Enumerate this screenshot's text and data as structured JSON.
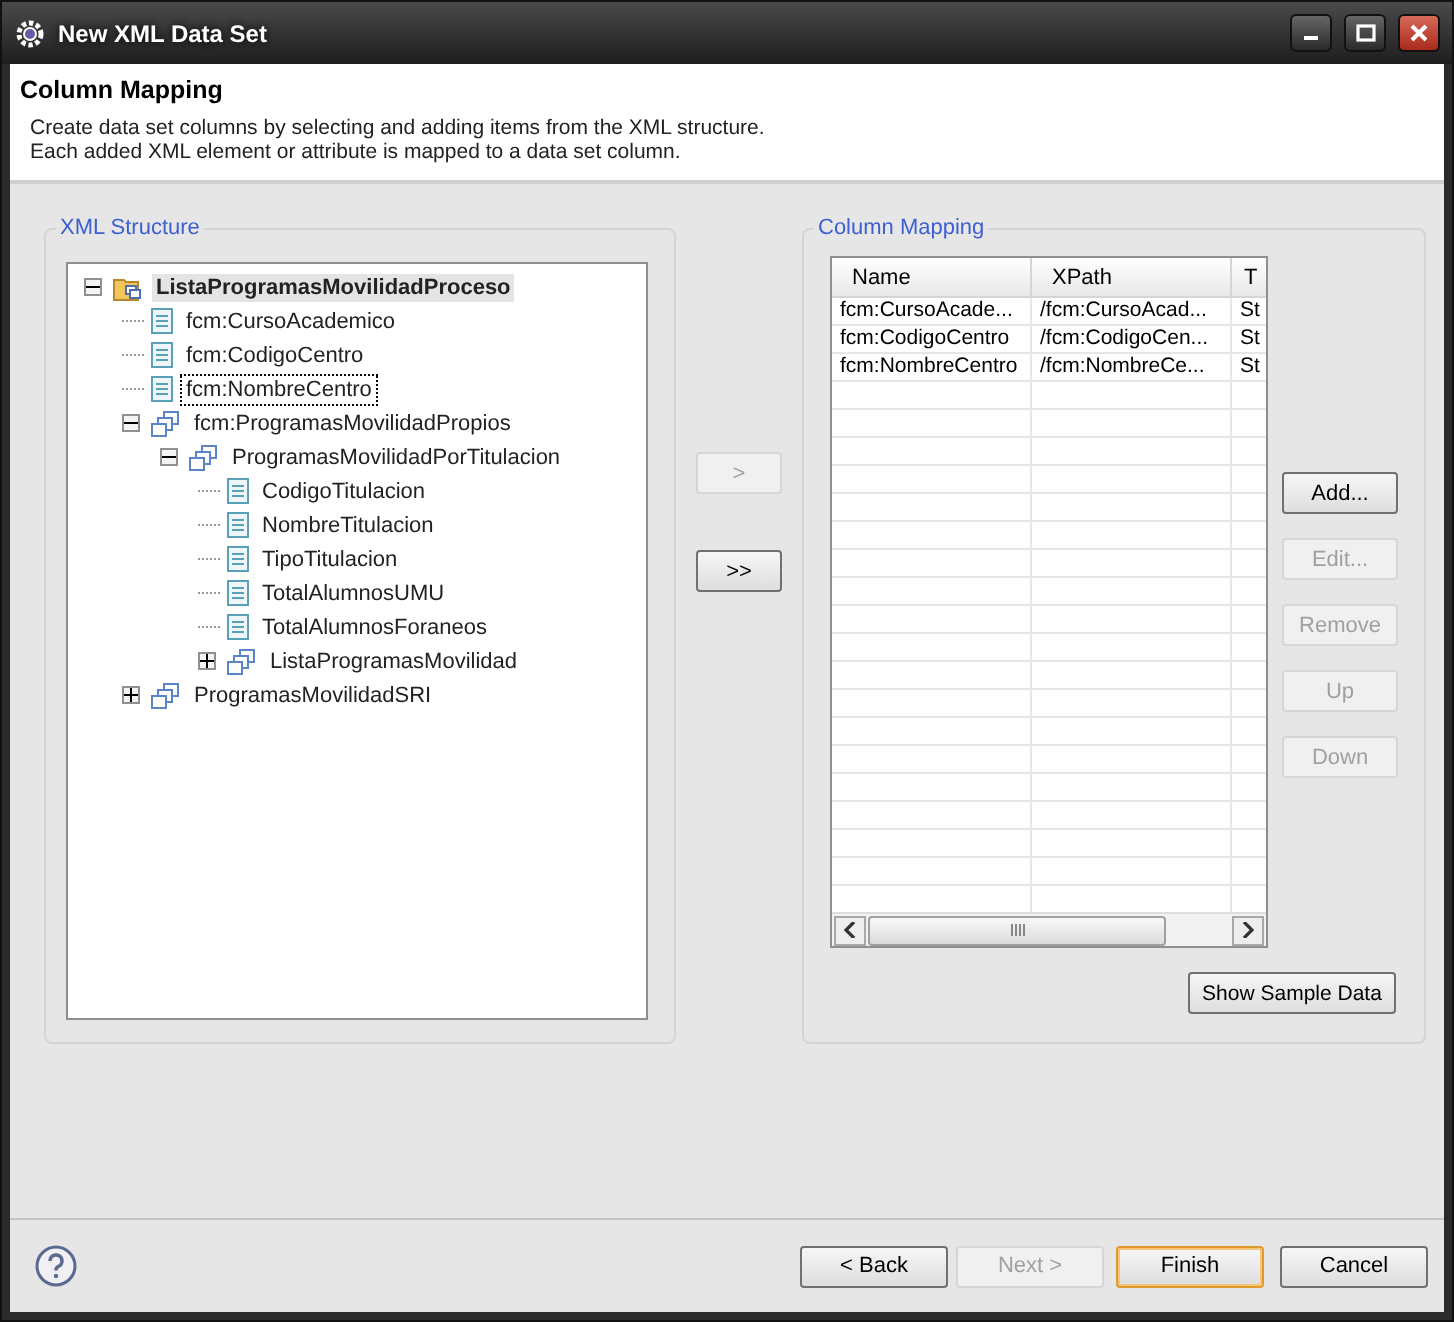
{
  "window": {
    "title": "New XML Data Set"
  },
  "header": {
    "title": "Column Mapping",
    "description": [
      "Create data set columns by selecting and adding items from the XML structure.",
      "Each added XML element or attribute is mapped to a data set column."
    ]
  },
  "xml_structure": {
    "title": "XML Structure",
    "tree": [
      {
        "label": "ListaProgramasMovilidadProceso",
        "kind": "folder",
        "expanded": true,
        "selected": true,
        "focused": false,
        "children": [
          {
            "label": "fcm:CursoAcademico",
            "kind": "leaf",
            "selected": false,
            "focused": false
          },
          {
            "label": "fcm:CodigoCentro",
            "kind": "leaf",
            "selected": false,
            "focused": false
          },
          {
            "label": "fcm:NombreCentro",
            "kind": "leaf",
            "selected": false,
            "focused": true
          },
          {
            "label": "fcm:ProgramasMovilidadPropios",
            "kind": "group",
            "expanded": true,
            "selected": false,
            "focused": false,
            "children": [
              {
                "label": "ProgramasMovilidadPorTitulacion",
                "kind": "group",
                "expanded": true,
                "selected": false,
                "focused": false,
                "children": [
                  {
                    "label": "CodigoTitulacion",
                    "kind": "leaf",
                    "selected": false,
                    "focused": false
                  },
                  {
                    "label": "NombreTitulacion",
                    "kind": "leaf",
                    "selected": false,
                    "focused": false
                  },
                  {
                    "label": "TipoTitulacion",
                    "kind": "leaf",
                    "selected": false,
                    "focused": false
                  },
                  {
                    "label": "TotalAlumnosUMU",
                    "kind": "leaf",
                    "selected": false,
                    "focused": false
                  },
                  {
                    "label": "TotalAlumnosForaneos",
                    "kind": "leaf",
                    "selected": false,
                    "focused": false
                  },
                  {
                    "label": "ListaProgramasMovilidad",
                    "kind": "group",
                    "expanded": false,
                    "selected": false,
                    "focused": false
                  }
                ]
              }
            ]
          },
          {
            "label": "ProgramasMovilidadSRI",
            "kind": "group",
            "expanded": false,
            "selected": false,
            "focused": false
          }
        ]
      }
    ]
  },
  "transfer_buttons": [
    {
      "label": ">",
      "disabled": true
    },
    {
      "label": ">>",
      "disabled": false
    }
  ],
  "column_mapping": {
    "title": "Column Mapping",
    "table": {
      "columns": [
        "Name",
        "XPath",
        "T"
      ],
      "rows": [
        [
          "fcm:CursoAcade...",
          "/fcm:CursoAcad...",
          "St"
        ],
        [
          "fcm:CodigoCentro",
          "/fcm:CodigoCen...",
          "St"
        ],
        [
          "fcm:NombreCentro",
          "/fcm:NombreCe...",
          "St"
        ]
      ]
    },
    "buttons": [
      {
        "label": "Add...",
        "disabled": false
      },
      {
        "label": "Edit...",
        "disabled": true
      },
      {
        "label": "Remove",
        "disabled": true
      },
      {
        "label": "Up",
        "disabled": true
      },
      {
        "label": "Down",
        "disabled": true
      }
    ],
    "show_sample_data": {
      "label": "Show Sample Data",
      "disabled": false
    }
  },
  "footer": {
    "buttons": [
      {
        "label": "< Back",
        "disabled": false,
        "default": false
      },
      {
        "label": "Next >",
        "disabled": true,
        "default": false
      },
      {
        "label": "Finish",
        "disabled": false,
        "default": true
      },
      {
        "label": "Cancel",
        "disabled": false,
        "default": false
      }
    ]
  }
}
